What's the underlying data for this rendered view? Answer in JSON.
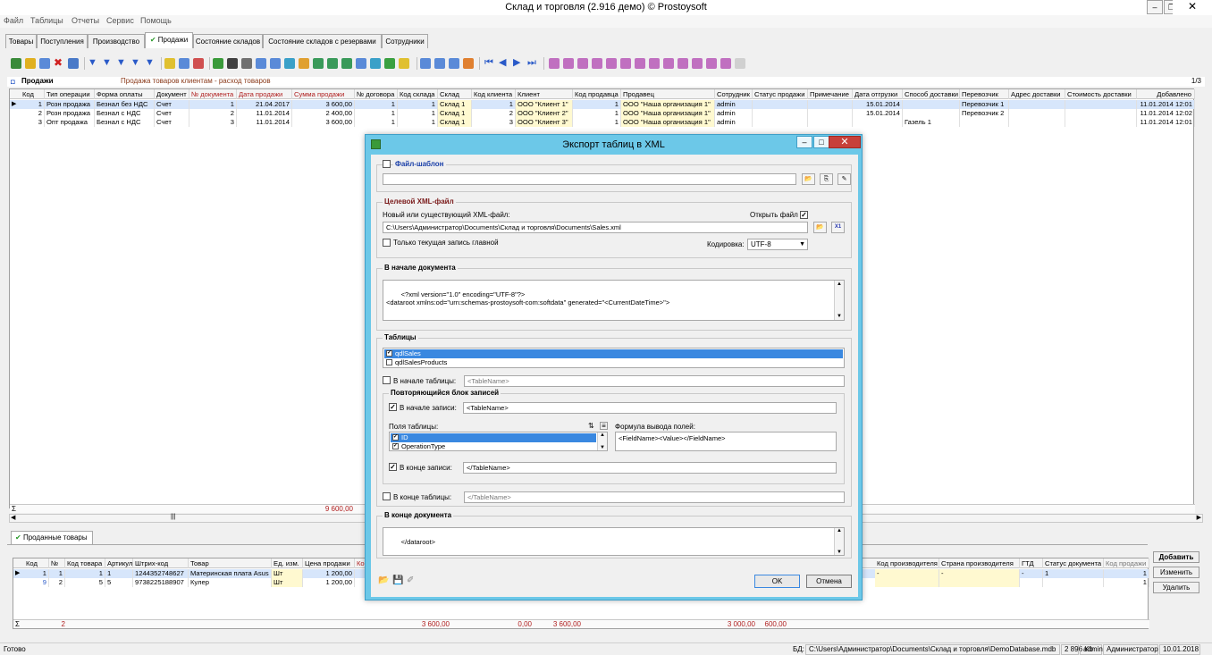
{
  "window": {
    "title": "Склад и торговля (2.916 демо) © Prostoysoft"
  },
  "menu": [
    "Файл",
    "Таблицы",
    "Отчеты",
    "Сервис",
    "Помощь"
  ],
  "tabs": [
    "Товары",
    "Поступления",
    "Производство",
    "Продажи",
    "Состояние складов",
    "Состояние складов с резервами",
    "Сотрудники"
  ],
  "panel": {
    "title": "Продажи",
    "subtitle": "Продажа товаров клиентам - расход товаров",
    "page": "1/3"
  },
  "grid": {
    "columns": [
      "Код",
      "Тип операции",
      "Форма оплаты",
      "Документ",
      "№ документа",
      "Дата продажи",
      "Сумма продажи",
      "№ договора",
      "Код склада",
      "Склад",
      "Код клиента",
      "Клиент",
      "Код продавца",
      "Продавец",
      "Сотрудник",
      "Статус продажи",
      "Примечание",
      "Дата отгрузки",
      "Способ доставки",
      "Перевозчик",
      "Адрес доставки",
      "Стоимость доставки",
      "Добавлено"
    ],
    "rows": [
      [
        "1",
        "Розн продажа",
        "Безнал без НДС",
        "Счет",
        "1",
        "21.04.2017",
        "3 600,00",
        "1",
        "1",
        "Склад 1",
        "1",
        "ООО \"Клиент 1\"",
        "1",
        "ООО \"Наша организация 1\"",
        "admin",
        "",
        "",
        "15.01.2014",
        "",
        "Перевозчик 1",
        "",
        "",
        "11.01.2014 12:01"
      ],
      [
        "2",
        "Розн продажа",
        "Безнал с НДС",
        "Счет",
        "2",
        "11.01.2014",
        "2 400,00",
        "1",
        "1",
        "Склад 1",
        "2",
        "ООО \"Клиент 2\"",
        "1",
        "ООО \"Наша организация 1\"",
        "admin",
        "",
        "",
        "15.01.2014",
        "",
        "Перевозчик 2",
        "",
        "",
        "11.01.2014 12:02"
      ],
      [
        "3",
        "Опт продажа",
        "Безнал с НДС",
        "Счет",
        "3",
        "11.01.2014",
        "3 600,00",
        "1",
        "1",
        "Склад 1",
        "3",
        "ООО \"Клиент 3\"",
        "1",
        "ООО \"Наша организация 1\"",
        "admin",
        "",
        "",
        "",
        "Газель 1",
        "",
        "",
        "",
        "11.01.2014 12:01"
      ]
    ],
    "sum_symbol": "Σ",
    "total": "9 600,00"
  },
  "bottom": {
    "tab": "Проданные товары",
    "columns": [
      "Код",
      "№",
      "Код товара",
      "Артикул",
      "Штрих-код",
      "Товар",
      "Ед. изм.",
      "Цена продажи",
      "Ко"
    ],
    "rows": [
      [
        "1",
        "1",
        "1",
        "1",
        "1244352748627",
        "Материнская плата Asus",
        "Шт",
        "1 200,00"
      ],
      [
        "9",
        "2",
        "5",
        "5",
        "9738225188907",
        "Кулер",
        "Шт",
        "1 200,00"
      ]
    ],
    "right_columns": [
      "Код производителя",
      "Страна производителя",
      "ГТД",
      "Статус документа",
      "Код продажи"
    ],
    "right_rows": [
      [
        "-",
        "-",
        "-",
        "1",
        "1"
      ],
      [
        "",
        "",
        "",
        "",
        "1"
      ]
    ],
    "buttons": [
      "Добавить",
      "Изменить",
      "Удалить"
    ],
    "sum_symbol": "Σ",
    "totals": [
      "2",
      "3 600,00",
      "0,00",
      "3 600,00",
      "3 000,00",
      "600,00"
    ]
  },
  "status": {
    "ready": "Готово",
    "db_label": "БД:",
    "db_path": "C:\\Users\\Администратор\\Documents\\Склад и торговля\\DemoDatabase.mdb",
    "size": "2 896 Kb",
    "user": "admin",
    "role": "Администратор",
    "date": "10.01.2018"
  },
  "dialog": {
    "title": "Экспорт таблиц в XML",
    "template_group": "Файл-шаблон",
    "target_group": "Целевой XML-файл",
    "file_label": "Новый или существующий XML-файл:",
    "open_file_label": "Открыть файл",
    "file_path": "C:\\Users\\Администратор\\Documents\\Склад и торговля\\Documents\\Sales.xml",
    "xl_button": "X1",
    "only_current": "Только текущая запись главной",
    "encoding_label": "Кодировка:",
    "encoding": "UTF-8",
    "doc_start_group": "В начале документа",
    "doc_start_text": "<?xml version=\"1.0\" encoding=\"UTF-8\"?>\n<dataroot xmlns:od=\"urn:schemas-prostoysoft-com:softdata\" generated=\"<CurrentDateTime>\">",
    "tables_group": "Таблицы",
    "tables": [
      "qdlSales",
      "qdlSalesProducts"
    ],
    "table_start_label": "В начале таблицы:",
    "table_start_value": "<TableName>",
    "repeat_group": "Повторяющийся блок записей",
    "record_start_label": "В начале записи:",
    "record_start_value": "<TableName>",
    "fields_label": "Поля таблицы:",
    "fields": [
      "ID",
      "OperationType"
    ],
    "formula_label": "Формула вывода полей:",
    "formula_value": "<FieldName><Value></FieldName>",
    "record_end_label": "В конце записи:",
    "record_end_value": "</TableName>",
    "table_end_label": "В конце таблицы:",
    "table_end_value": "</TableName>",
    "doc_end_group": "В конце документа",
    "doc_end_text": "</dataroot>",
    "ok": "OK",
    "cancel": "Отмена"
  }
}
